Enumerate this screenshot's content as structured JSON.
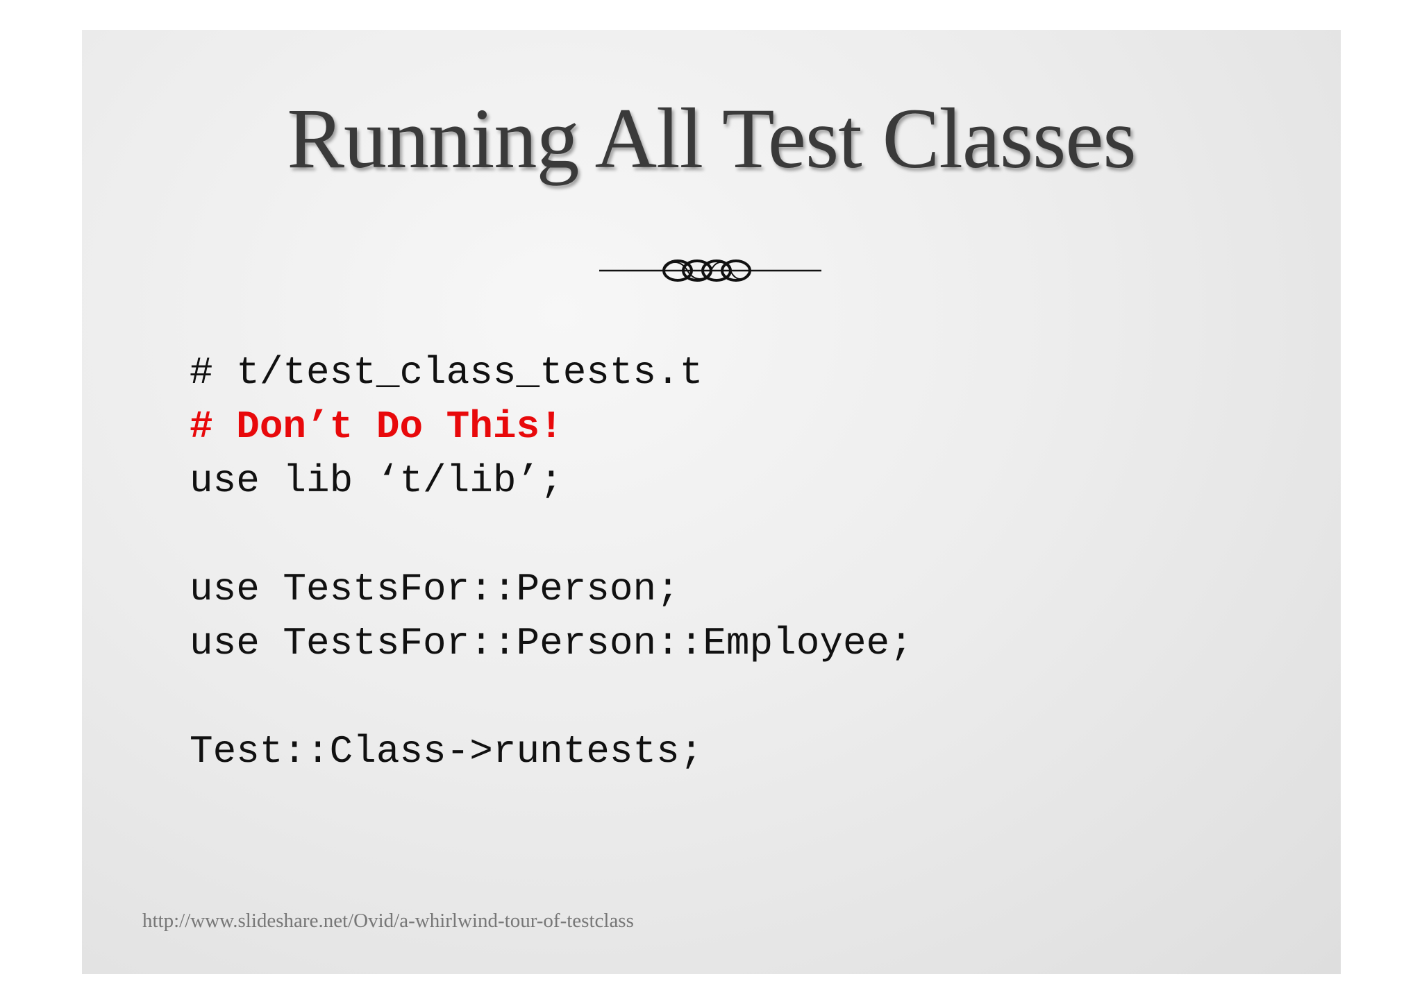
{
  "slide": {
    "title": "Running All Test Classes",
    "ornament_icon": "swirl-divider-icon",
    "code": {
      "line_1": "# t/test_class_tests.t",
      "line_2": "# Don’t Do This!",
      "line_3": "use lib ‘t/lib’;",
      "line_4": "use TestsFor::Person;",
      "line_5": "use TestsFor::Person::Employee;",
      "line_6": "Test::Class->runtests;"
    },
    "footer_url": "http://www.slideshare.net/Ovid/a-whirlwind-tour-of-testclass"
  },
  "colors": {
    "title": "#3a3a3a",
    "code": "#111111",
    "warning": "#e8090b",
    "footer": "#777777"
  }
}
